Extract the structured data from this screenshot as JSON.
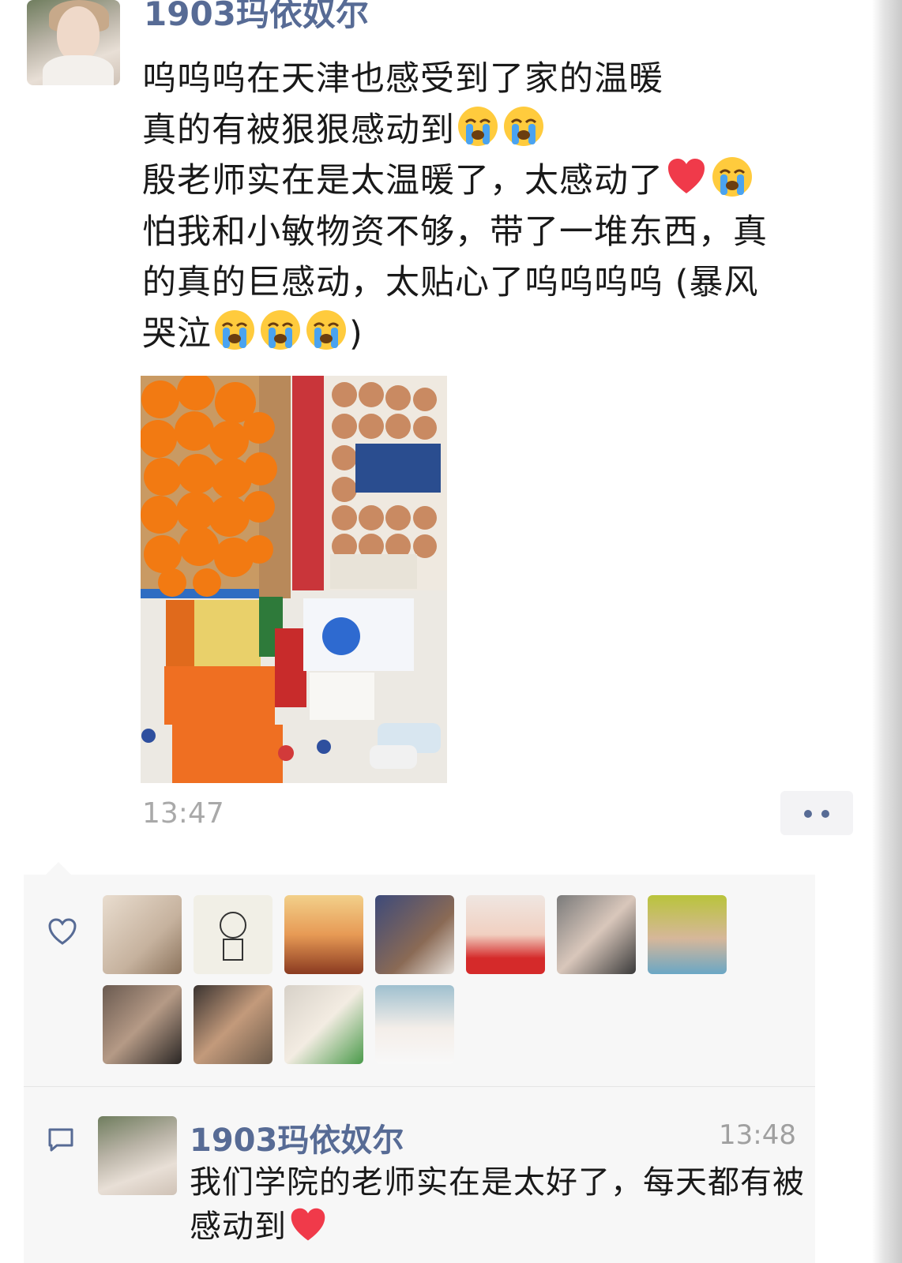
{
  "post": {
    "author": "1903玛依奴尔",
    "lines": [
      "呜呜呜在天津也感受到了家的温暖",
      "真的有被狠狠感动到",
      "殷老师实在是太温暖了，太感动了",
      "怕我和小敏物资不够，带了一堆东西，真",
      "的真的巨感动，太贴心了呜呜呜呜 (暴风",
      "哭泣",
      ")"
    ],
    "time": "13:47"
  },
  "icons": {
    "crying": "loudly-crying-face-emoji",
    "heart": "red-heart-emoji",
    "like": "heart-outline-icon",
    "comment": "comment-bubble-icon",
    "more": "more-dots-icon"
  },
  "colors": {
    "name_link": "#576b95",
    "text": "#191919",
    "muted": "#a9a9a9",
    "panel": "#f7f7f7"
  },
  "likes": {
    "count": 11
  },
  "comment": {
    "author": "1903玛依奴尔",
    "time": "13:48",
    "text": "我们学院的老师实在是太好了，每天都有被感动到"
  }
}
